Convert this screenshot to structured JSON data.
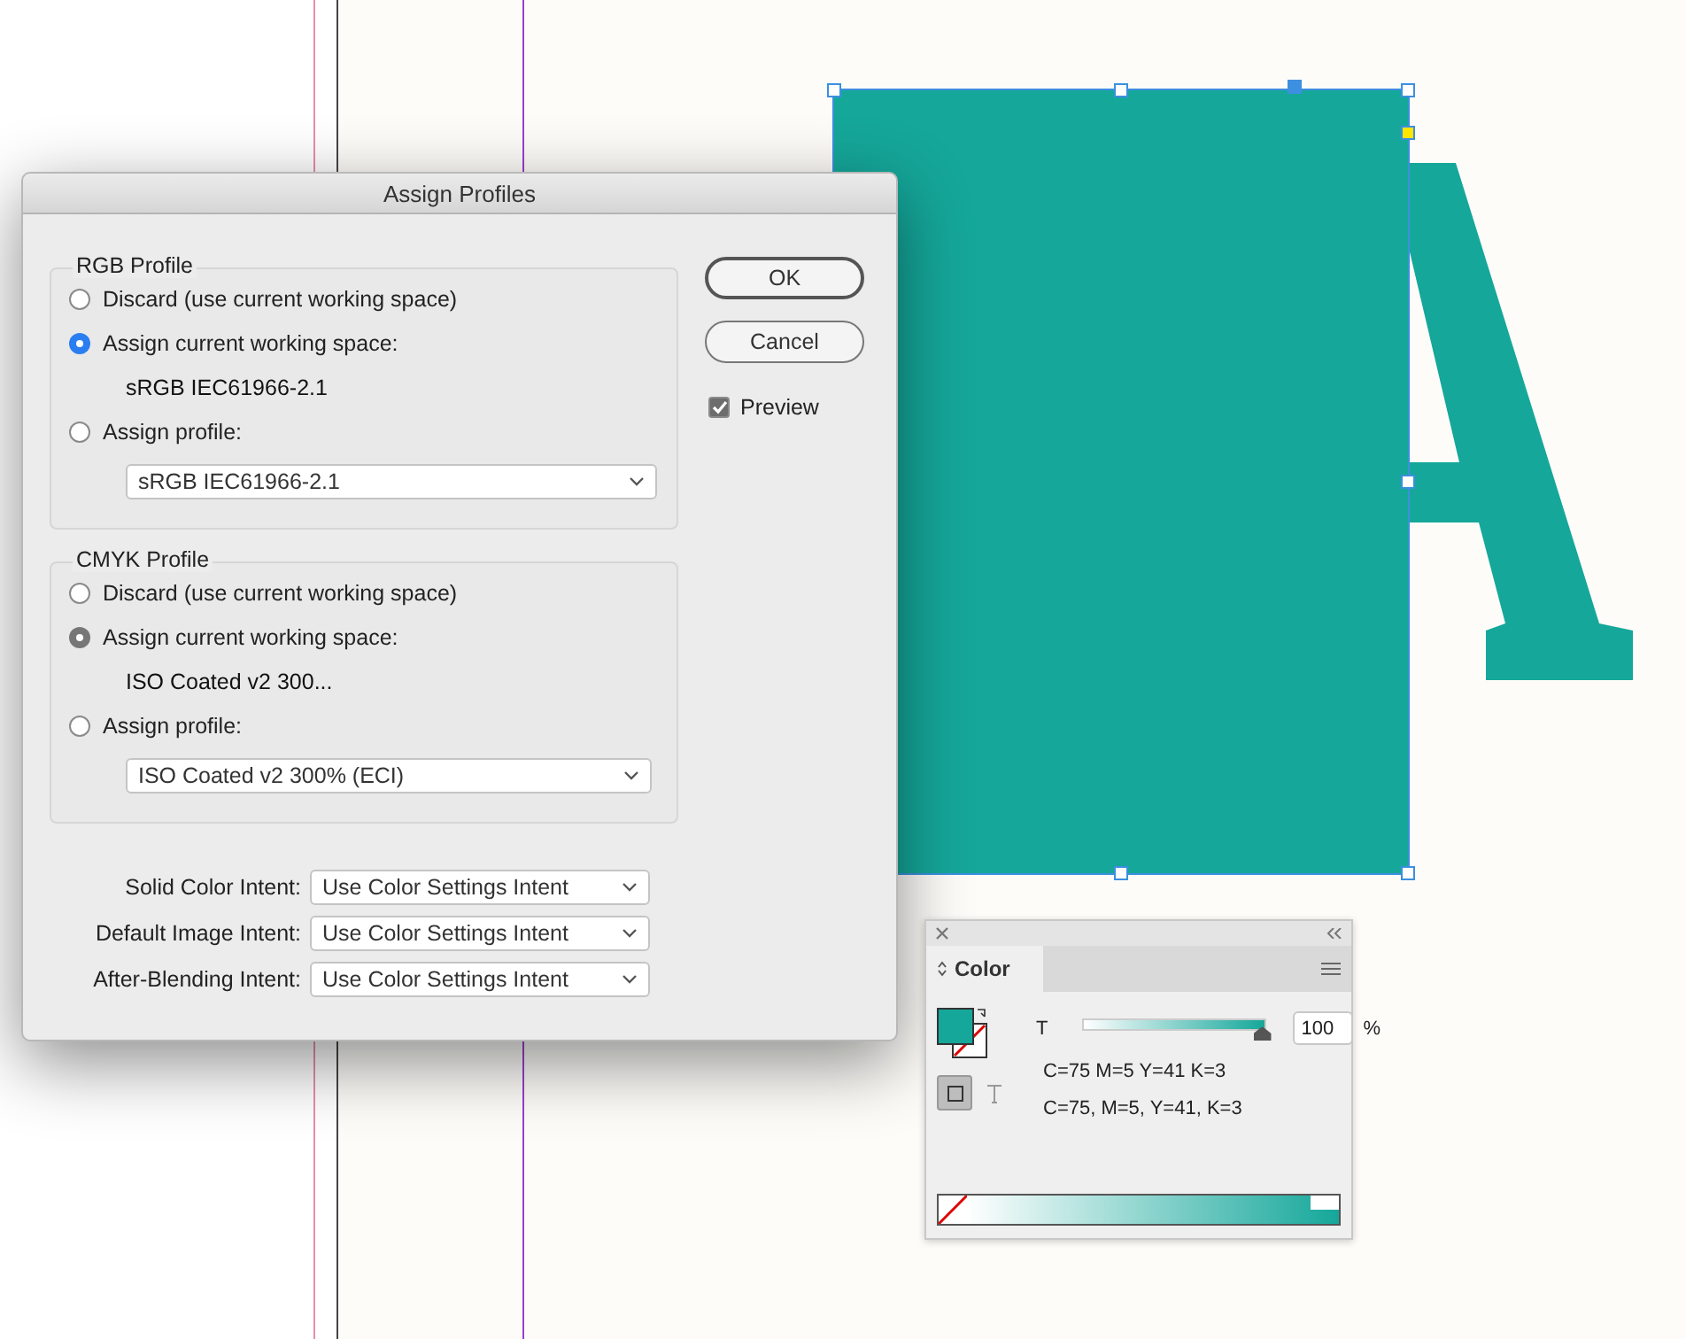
{
  "dialog": {
    "title": "Assign Profiles",
    "groups": [
      {
        "legend": "RGB Profile",
        "color": "#2a7ef0",
        "options": [
          {
            "kind": "plain",
            "label": "Discard (use current working space)",
            "selected": false
          },
          {
            "kind": "text",
            "label": "Assign current working space:",
            "selected": true,
            "detail": "sRGB IEC61966-2.1"
          },
          {
            "kind": "select",
            "label": "Assign profile:",
            "selected": false,
            "detail": "sRGB IEC61966-2.1"
          }
        ]
      },
      {
        "legend": "CMYK Profile",
        "color": "#777777",
        "options": [
          {
            "kind": "plain",
            "label": "Discard (use current working space)",
            "selected": false
          },
          {
            "kind": "text",
            "label": "Assign current working space:",
            "selected": true,
            "detail": "ISO Coated v2 300..."
          },
          {
            "kind": "select",
            "label": "Assign profile:",
            "selected": false,
            "detail": "ISO Coated v2 300% (ECI)"
          }
        ]
      }
    ],
    "buttons": [
      {
        "label": "OK",
        "default": true
      },
      {
        "label": "Cancel",
        "default": false
      }
    ],
    "preview": {
      "label": "Preview",
      "checked": true
    },
    "intents": [
      {
        "label": "Solid Color Intent:",
        "value": "Use Color Settings Intent"
      },
      {
        "label": "Default Image Intent:",
        "value": "Use Color Settings Intent"
      },
      {
        "label": "After-Blending Intent:",
        "value": "Use Color Settings Intent"
      }
    ]
  },
  "color_panel": {
    "tab": "Color",
    "tint_label": "T",
    "level": 1,
    "tint_value": "100",
    "unit": "%",
    "readout_1": "C=75 M=5 Y=41 K=3",
    "readout_2": "C=75, M=5, Y=41, K=3"
  }
}
